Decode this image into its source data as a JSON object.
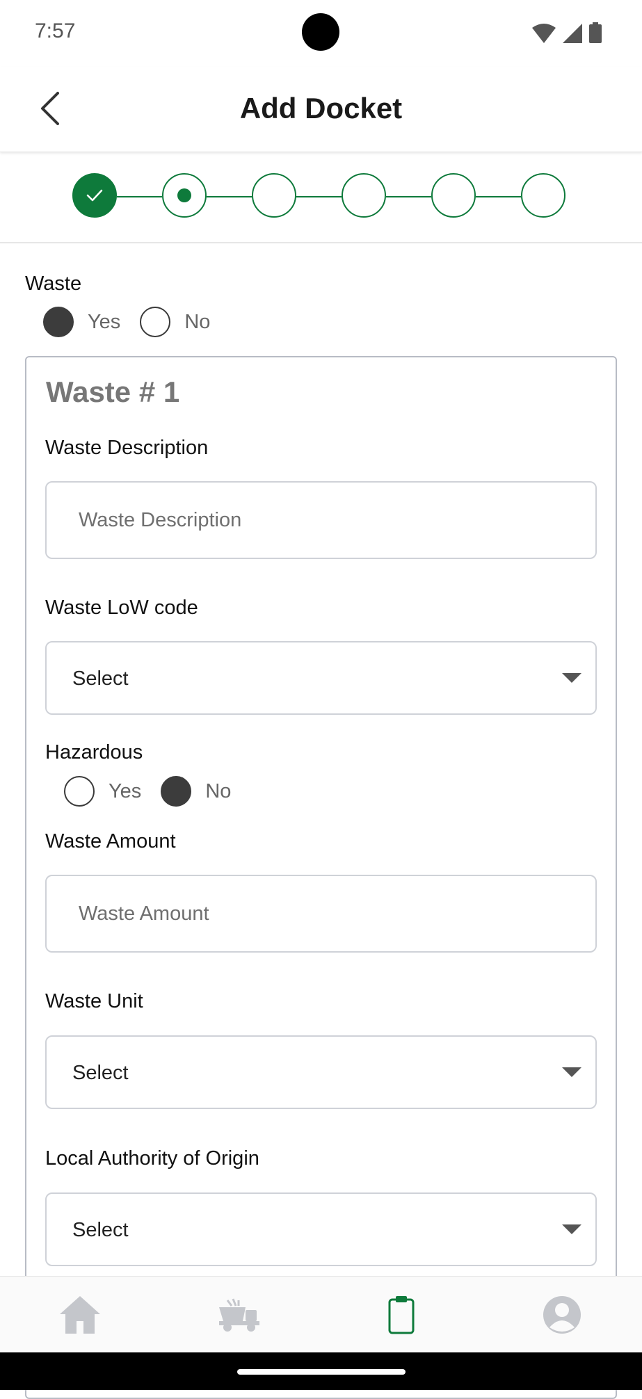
{
  "status": {
    "time": "7:57"
  },
  "header": {
    "title": "Add Docket"
  },
  "stepper": {
    "total": 6,
    "completed": 1,
    "current_step": 2
  },
  "waste_toggle": {
    "label": "Waste",
    "yes": "Yes",
    "no": "No",
    "selected": "Yes"
  },
  "card": {
    "title": "Waste # 1",
    "description": {
      "label": "Waste Description",
      "placeholder": "Waste Description"
    },
    "low_code": {
      "label": "Waste LoW code",
      "value": "Select"
    },
    "hazardous": {
      "label": "Hazardous",
      "yes": "Yes",
      "no": "No",
      "selected": "No"
    },
    "amount": {
      "label": "Waste Amount",
      "placeholder": "Waste Amount"
    },
    "unit": {
      "label": "Waste Unit",
      "value": "Select"
    },
    "authority": {
      "label": "Local Authority of Origin",
      "value": "Select"
    }
  },
  "nav": {
    "items": [
      "home-icon",
      "skip-truck-icon",
      "clipboard-icon",
      "profile-icon"
    ],
    "active": "clipboard-icon",
    "active_color": "#0e7a3b",
    "inactive_color": "#c4c6cb"
  },
  "colors": {
    "accent": "#0e7a3b"
  }
}
